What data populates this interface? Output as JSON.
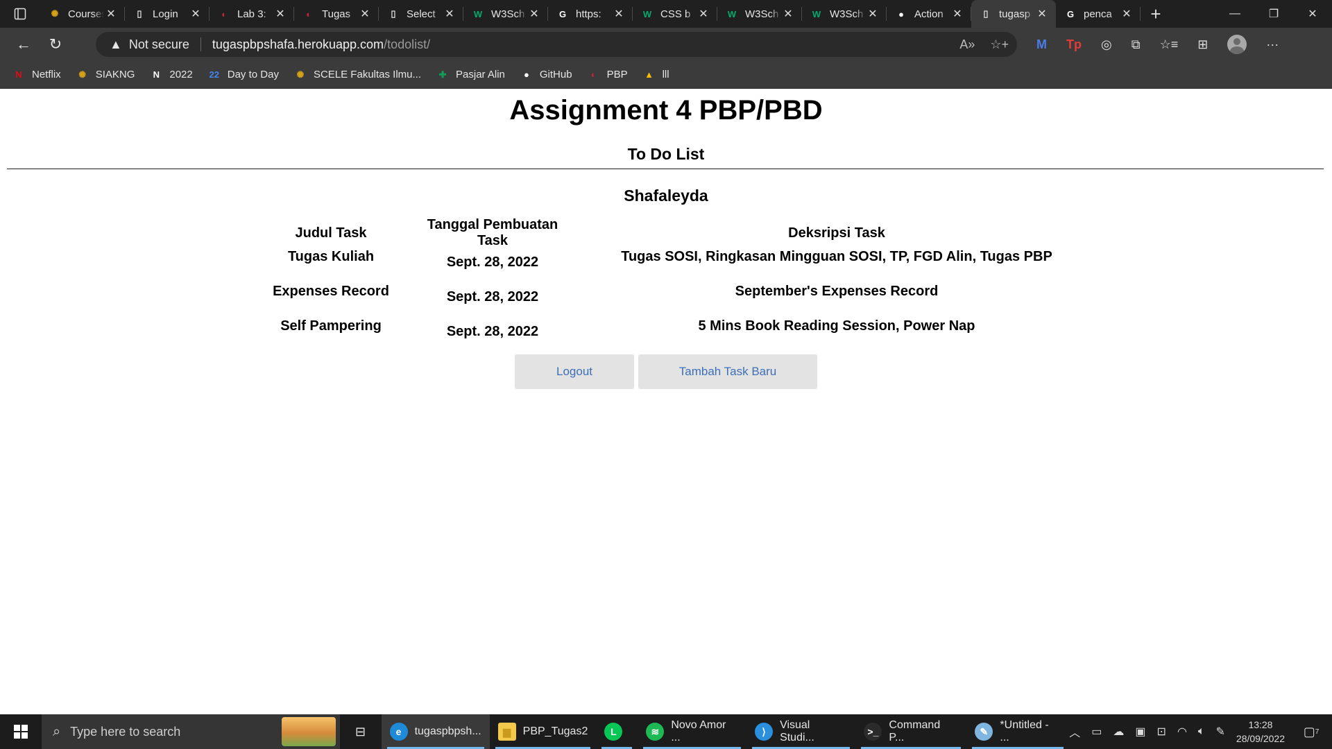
{
  "browser": {
    "tabs": [
      {
        "title": "Courses",
        "icon": "ui-logo-icon",
        "icon_glyph": "✺",
        "icon_color": "#d4a017"
      },
      {
        "title": "Login",
        "icon": "page-icon",
        "icon_glyph": "▯",
        "icon_color": "#dddddd"
      },
      {
        "title": "Lab 3:",
        "icon": "pbp-logo-icon",
        "icon_glyph": "◐",
        "icon_color": "#c0263a"
      },
      {
        "title": "Tugas",
        "icon": "pbp-logo-icon",
        "icon_glyph": "◐",
        "icon_color": "#c0263a"
      },
      {
        "title": "Select",
        "icon": "page-icon",
        "icon_glyph": "▯",
        "icon_color": "#dddddd"
      },
      {
        "title": "W3Sch",
        "icon": "w3schools-icon",
        "icon_glyph": "W",
        "icon_color": "#04aa6d"
      },
      {
        "title": "https:",
        "icon": "google-icon",
        "icon_glyph": "G",
        "icon_color": "#ffffff"
      },
      {
        "title": "CSS b",
        "icon": "w3schools-icon",
        "icon_glyph": "W",
        "icon_color": "#04aa6d"
      },
      {
        "title": "W3Sch",
        "icon": "w3schools-icon",
        "icon_glyph": "W",
        "icon_color": "#04aa6d"
      },
      {
        "title": "W3Sch",
        "icon": "w3schools-icon",
        "icon_glyph": "W",
        "icon_color": "#04aa6d"
      },
      {
        "title": "Action",
        "icon": "github-icon",
        "icon_glyph": "●",
        "icon_color": "#ffffff"
      },
      {
        "title": "tugasp",
        "icon": "page-icon",
        "icon_glyph": "▯",
        "icon_color": "#dddddd",
        "active": true
      },
      {
        "title": "penca",
        "icon": "google-icon",
        "icon_glyph": "G",
        "icon_color": "#ffffff"
      }
    ],
    "security_label": "Not secure",
    "url_host": "tugaspbpshafa.herokuapp.com",
    "url_path": "/todolist/",
    "bookmarks": [
      {
        "label": "Netflix",
        "icon": "netflix-icon",
        "glyph": "N",
        "color": "#e50914"
      },
      {
        "label": "SIAKNG",
        "icon": "ui-logo-icon",
        "glyph": "✺",
        "color": "#d4a017"
      },
      {
        "label": "2022",
        "icon": "notion-icon",
        "glyph": "N",
        "color": "#ffffff"
      },
      {
        "label": "Day to Day",
        "icon": "calendar-icon",
        "glyph": "22",
        "color": "#4285f4"
      },
      {
        "label": "SCELE Fakultas Ilmu...",
        "icon": "ui-logo-icon",
        "glyph": "✺",
        "color": "#d4a017"
      },
      {
        "label": "Pasjar Alin",
        "icon": "sheets-icon",
        "glyph": "✚",
        "color": "#0f9d58"
      },
      {
        "label": "GitHub",
        "icon": "github-icon",
        "glyph": "●",
        "color": "#ffffff"
      },
      {
        "label": "PBP",
        "icon": "pbp-logo-icon",
        "glyph": "◐",
        "color": "#c0263a"
      },
      {
        "label": "lll",
        "icon": "drive-icon",
        "glyph": "▲",
        "color": "#fbbc04"
      }
    ]
  },
  "page": {
    "title": "Assignment 4 PBP/PBD",
    "subtitle": "To Do List",
    "username": "Shafaleyda",
    "table": {
      "headers": [
        "Judul Task",
        "Tanggal Pembuatan Task",
        "Deksripsi Task"
      ],
      "rows": [
        {
          "judul": "Tugas Kuliah",
          "tanggal": "Sept. 28, 2022",
          "deskripsi": "Tugas SOSI, Ringkasan Mingguan SOSI, TP, FGD Alin, Tugas PBP"
        },
        {
          "judul": "Expenses Record",
          "tanggal": "Sept. 28, 2022",
          "deskripsi": "September's Expenses Record"
        },
        {
          "judul": "Self Pampering",
          "tanggal": "Sept. 28, 2022",
          "deskripsi": "5 Mins Book Reading Session, Power Nap"
        }
      ]
    },
    "buttons": {
      "logout": "Logout",
      "add_task": "Tambah Task Baru"
    }
  },
  "taskbar": {
    "search_placeholder": "Type here to search",
    "apps": [
      {
        "label": "tugaspbpsh...",
        "icon": "edge-icon",
        "color": "#1f8ad8",
        "glyph": "e",
        "active": true
      },
      {
        "label": "PBP_Tugas2",
        "icon": "folder-icon",
        "color": "#f2c94c",
        "glyph": "▆"
      },
      {
        "label": "",
        "icon": "line-app-icon",
        "color": "#06c755",
        "glyph": "L"
      },
      {
        "label": "Novo Amor ...",
        "icon": "spotify-icon",
        "color": "#1db954",
        "glyph": "≋"
      },
      {
        "label": "Visual Studi...",
        "icon": "vscode-icon",
        "color": "#2a8fdd",
        "glyph": "⟩"
      },
      {
        "label": "Command P...",
        "icon": "terminal-icon",
        "color": "#2b2b2b",
        "glyph": ">_"
      },
      {
        "label": "*Untitled - ...",
        "icon": "notepad-icon",
        "color": "#7fb6e0",
        "glyph": "✎"
      }
    ],
    "time": "13:28",
    "date": "28/09/2022",
    "notification_count": "7"
  }
}
